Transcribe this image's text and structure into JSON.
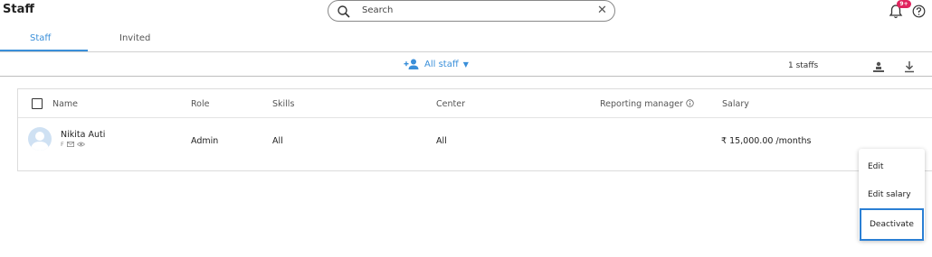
{
  "header": {
    "title": "Staff",
    "notification_badge": "9+"
  },
  "search": {
    "placeholder": "Search"
  },
  "tabs": [
    {
      "label": "Staff",
      "active": true
    },
    {
      "label": "Invited",
      "active": false
    }
  ],
  "toolbar": {
    "filter_label": "All staff",
    "count": "1 staffs"
  },
  "table": {
    "columns": [
      "Name",
      "Role",
      "Skills",
      "Center",
      "Reporting manager",
      "Salary"
    ],
    "rows": [
      {
        "name": "Nikita Auti",
        "gender": "F",
        "role": "Admin",
        "skills": "All",
        "center": "All",
        "reporting_manager": "",
        "salary": "₹ 15,000.00 /months"
      }
    ]
  },
  "context_menu": {
    "items": [
      "Edit",
      "Edit salary",
      "Deactivate"
    ]
  },
  "colors": {
    "accent": "#3a8fd9",
    "badge": "#e0245e",
    "focus": "#2a7fd4"
  }
}
